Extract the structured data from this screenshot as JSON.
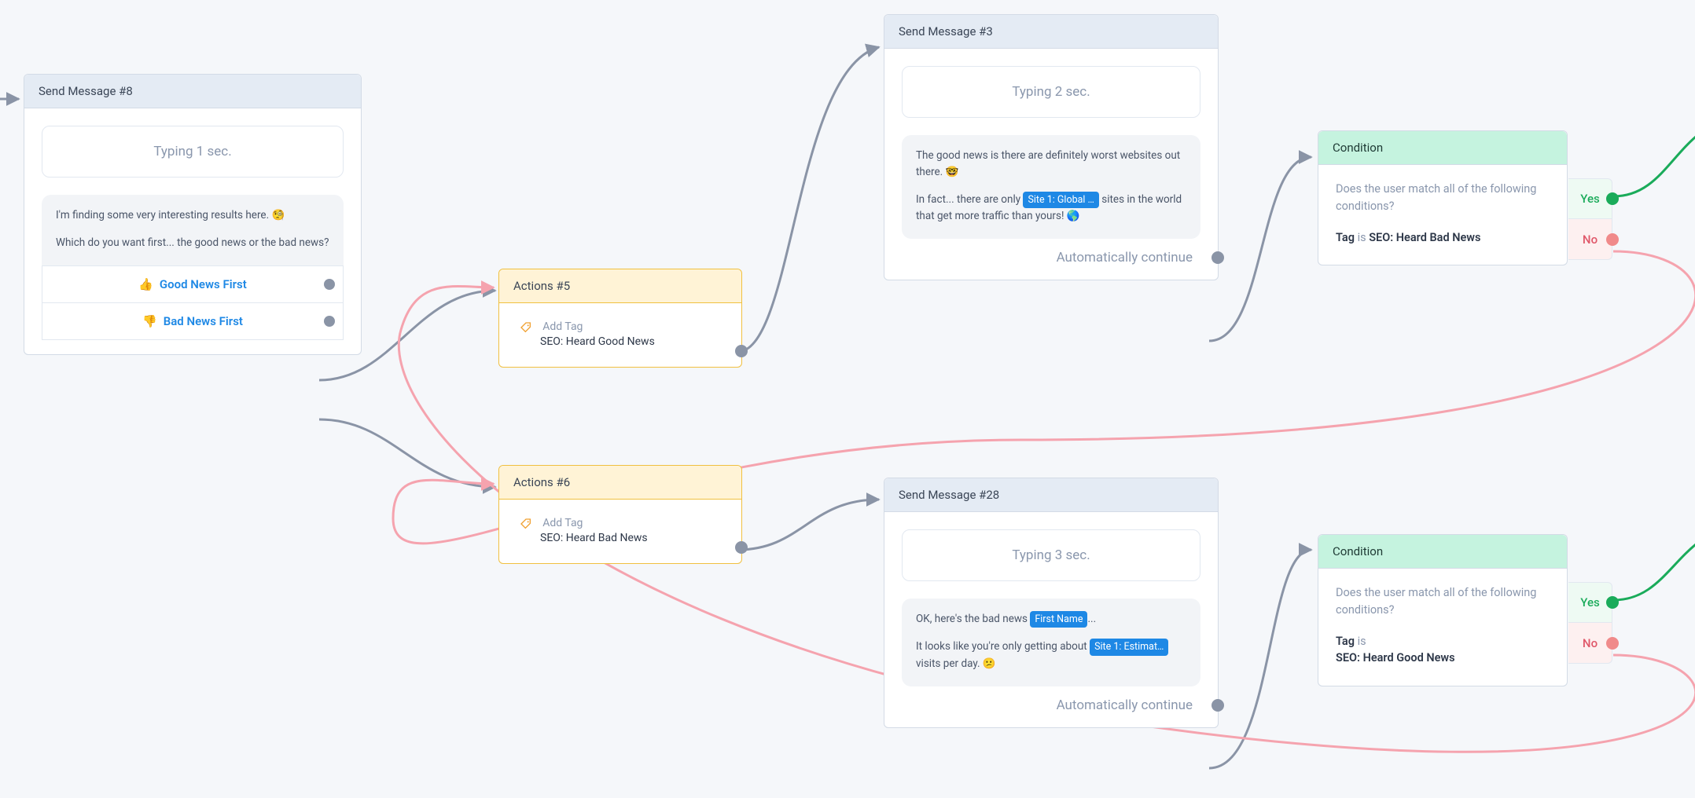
{
  "nodes": {
    "send8": {
      "title": "Send Message #8",
      "typing": "Typing 1 sec.",
      "msg_line1": "I'm finding some very interesting results here. 🧐",
      "msg_line2": "Which do you want first... the good news or the bad news?",
      "choice_good": "Good News First",
      "choice_good_emoji": "👍",
      "choice_bad": "Bad News First",
      "choice_bad_emoji": "👎"
    },
    "actions5": {
      "title": "Actions #5",
      "label": "Add Tag",
      "value": "SEO: Heard Good News"
    },
    "actions6": {
      "title": "Actions #6",
      "label": "Add Tag",
      "value": "SEO: Heard Bad News"
    },
    "send3": {
      "title": "Send Message #3",
      "typing": "Typing 2 sec.",
      "msg_p1": "The good news is there are definitely worst websites out there. 🤓",
      "msg_p2a": "In fact... there are only ",
      "chip": "Site 1: Global …",
      "msg_p2b": " sites in the world that get more traffic than yours! 🌎",
      "auto": "Automatically continue"
    },
    "send28": {
      "title": "Send Message #28",
      "typing": "Typing 3 sec.",
      "msg_p1a": "OK, here's the bad news ",
      "chip_name": "First Name",
      "msg_p1b": "...",
      "msg_p2a": "It looks like you're only getting about ",
      "chip_est": "Site 1: Estimat…",
      "msg_p2b": " visits per day. 😕",
      "auto": "Automatically continue"
    },
    "cond1": {
      "title": "Condition",
      "question": "Does the user match all of the following conditions?",
      "rule_field": "Tag",
      "rule_op": "is",
      "rule_value": "SEO: Heard Bad News",
      "yes": "Yes",
      "no": "No"
    },
    "cond2": {
      "title": "Condition",
      "question": "Does the user match all of the following conditions?",
      "rule_field": "Tag",
      "rule_op": "is",
      "rule_value": "SEO: Heard Good News",
      "yes": "Yes",
      "no": "No"
    }
  }
}
